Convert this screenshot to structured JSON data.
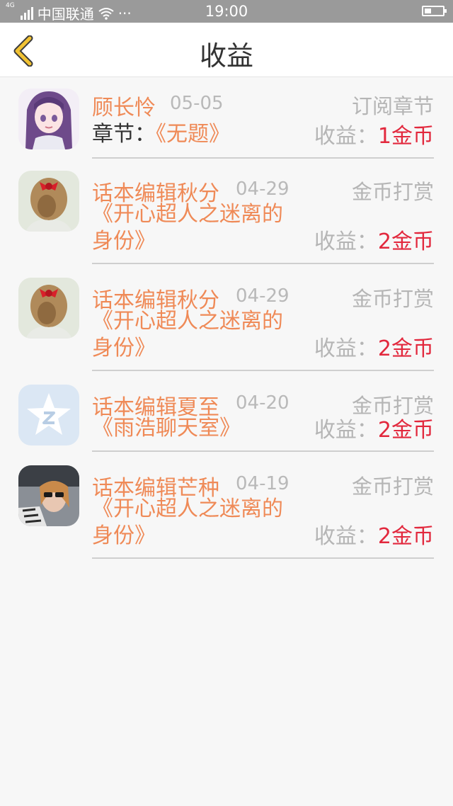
{
  "status_bar": {
    "network": "4G",
    "carrier": "中国联通",
    "more": "···",
    "time": "19:00"
  },
  "header": {
    "title": "收益"
  },
  "records": [
    {
      "name": "顾长怜",
      "date": "05-05",
      "type": "订阅章节",
      "chapter_label": "章节：",
      "chapter": "《无题》",
      "income_label": "收益：",
      "amount": "1金币",
      "avatar": "anime-girl-avatar"
    },
    {
      "name": "话本编辑秋分",
      "date": "04-29",
      "type": "金币打赏",
      "chapter": "《开心超人之迷离的身份》",
      "income_label": "收益：",
      "amount": "2金币",
      "avatar": "hair-bow-avatar"
    },
    {
      "name": "话本编辑秋分",
      "date": "04-29",
      "type": "金币打赏",
      "chapter": "《开心超人之迷离的身份》",
      "income_label": "收益：",
      "amount": "2金币",
      "avatar": "hair-bow-avatar"
    },
    {
      "name": "话本编辑夏至",
      "date": "04-20",
      "type": "金币打赏",
      "chapter": "《雨浩聊天室》",
      "income_label": "收益：",
      "amount": "2金币",
      "avatar": "star-z-avatar"
    },
    {
      "name": "话本编辑芒种",
      "date": "04-19",
      "type": "金币打赏",
      "chapter": "《开心超人之迷离的身份》",
      "income_label": "收益：",
      "amount": "2金币",
      "avatar": "photo-avatar"
    }
  ],
  "colors": {
    "accent_orange": "#ef8a57",
    "amount_red": "#e2283d",
    "muted_gray": "#b5b5b5",
    "back_yellow": "#f1c232"
  }
}
